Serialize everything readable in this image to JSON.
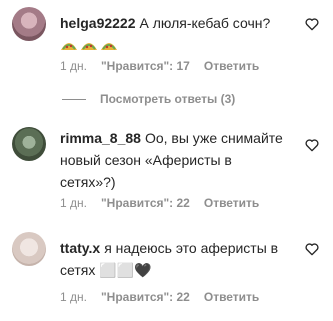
{
  "comments": [
    {
      "username": "helga92222",
      "text": "А люля-кебаб сочн?",
      "emoji_icons": [
        "taco-icon",
        "taco-icon",
        "taco-icon"
      ],
      "time": "1 дн.",
      "likes": "\"Нравится\": 17",
      "reply": "Ответить"
    },
    {
      "username": "rimma_8_88",
      "text": "Оо, вы уже снимайте новый сезон «Аферисты в сетях»?)",
      "time": "1 дн.",
      "likes": "\"Нравится\": 22",
      "reply": "Ответить"
    },
    {
      "username": "ttaty.x",
      "text": "я надеюсь это аферисты в сетях ⬜⬜🖤",
      "time": "1 дн.",
      "likes": "\"Нравится\": 22",
      "reply": "Ответить"
    }
  ],
  "view_replies": "Посмотреть ответы (3)",
  "icons": {
    "like": "heart-outline-icon"
  }
}
